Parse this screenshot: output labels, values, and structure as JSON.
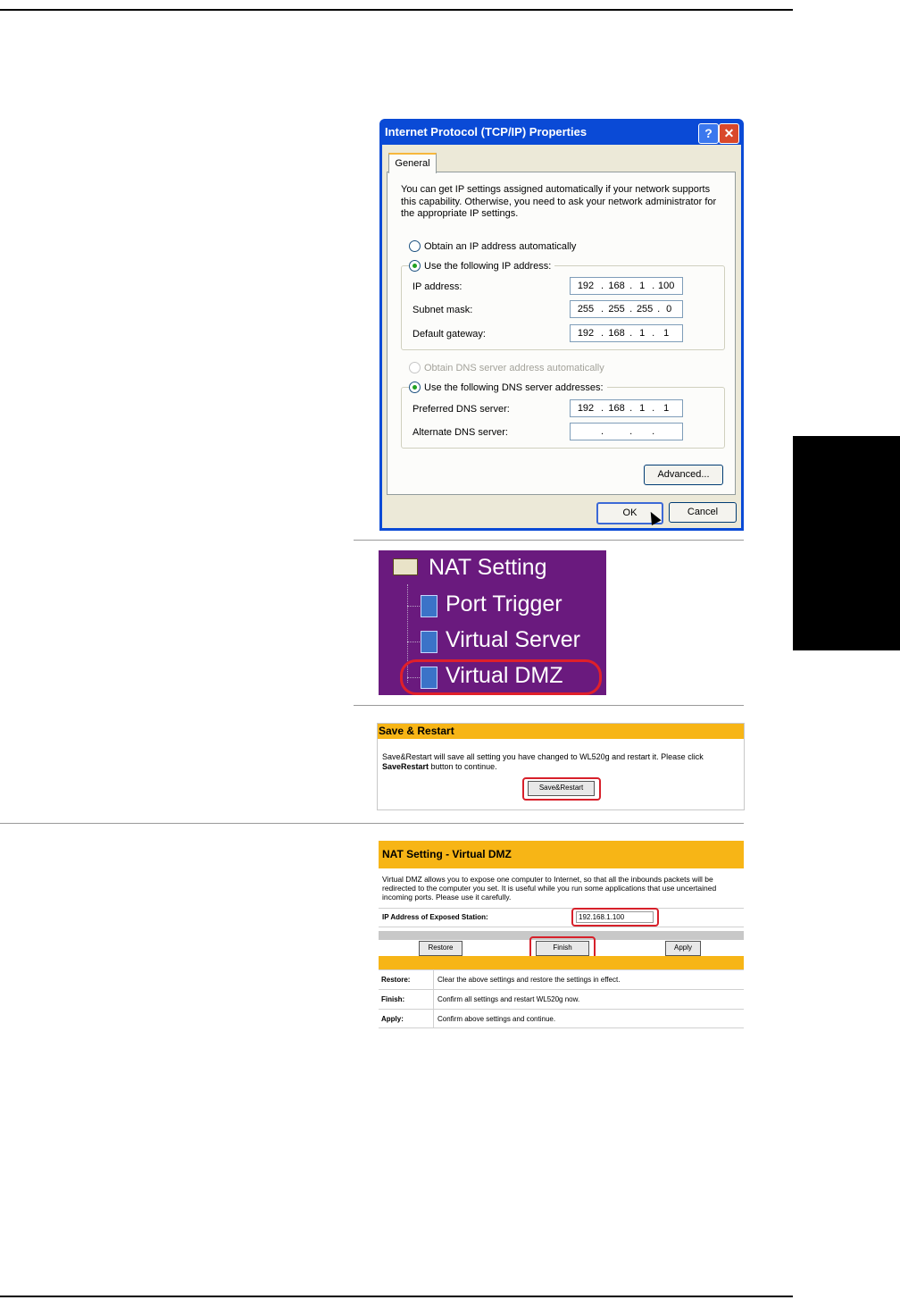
{
  "tcpip_dialog": {
    "title": "Internet Protocol (TCP/IP) Properties",
    "help_glyph": "?",
    "close_glyph": "✕",
    "tab": "General",
    "description": "You can get IP settings assigned automatically if your network supports this capability. Otherwise, you need to ask your network administrator for the appropriate IP settings.",
    "radio_auto_ip": "Obtain an IP address automatically",
    "radio_manual_ip": "Use the following IP address:",
    "ip_label": "IP address:",
    "ip_value": [
      "192",
      "168",
      "1",
      "100"
    ],
    "mask_label": "Subnet mask:",
    "mask_value": [
      "255",
      "255",
      "255",
      "0"
    ],
    "gateway_label": "Default gateway:",
    "gateway_value": [
      "192",
      "168",
      "1",
      "1"
    ],
    "radio_auto_dns": "Obtain DNS server address automatically",
    "radio_manual_dns": "Use the following DNS server addresses:",
    "pref_dns_label": "Preferred DNS server:",
    "pref_dns_value": [
      "192",
      "168",
      "1",
      "1"
    ],
    "alt_dns_label": "Alternate DNS server:",
    "alt_dns_value": [
      "",
      "",
      "",
      ""
    ],
    "advanced_button": "Advanced...",
    "ok_button": "OK",
    "cancel_button": "Cancel"
  },
  "nat_menu": {
    "folder": "NAT Setting",
    "items": [
      "Port Trigger",
      "Virtual Server",
      "Virtual DMZ"
    ]
  },
  "save_restart": {
    "title": "Save & Restart",
    "text_a": "Save&Restart will save all setting you have changed to WL520g and restart it. Please click ",
    "text_bold": "SaveRestart",
    "text_b": " button to continue.",
    "button": "Save&Restart"
  },
  "virtual_dmz": {
    "title": "NAT Setting - Virtual DMZ",
    "description": "Virtual DMZ allows you to expose one computer to Internet, so that all the inbounds packets will be redirected to the computer you set. It is useful while you run some applications that use uncertained incoming ports. Please use it carefully.",
    "field_label": "IP Address of Exposed Station:",
    "field_value": "192.168.1.100",
    "buttons": {
      "restore": "Restore",
      "finish": "Finish",
      "apply": "Apply"
    },
    "legend": [
      {
        "term": "Restore:",
        "desc": "Clear the above settings and restore the settings in effect."
      },
      {
        "term": "Finish:",
        "desc": "Confirm all settings and restart WL520g now."
      },
      {
        "term": "Apply:",
        "desc": "Confirm above settings and continue."
      }
    ]
  }
}
